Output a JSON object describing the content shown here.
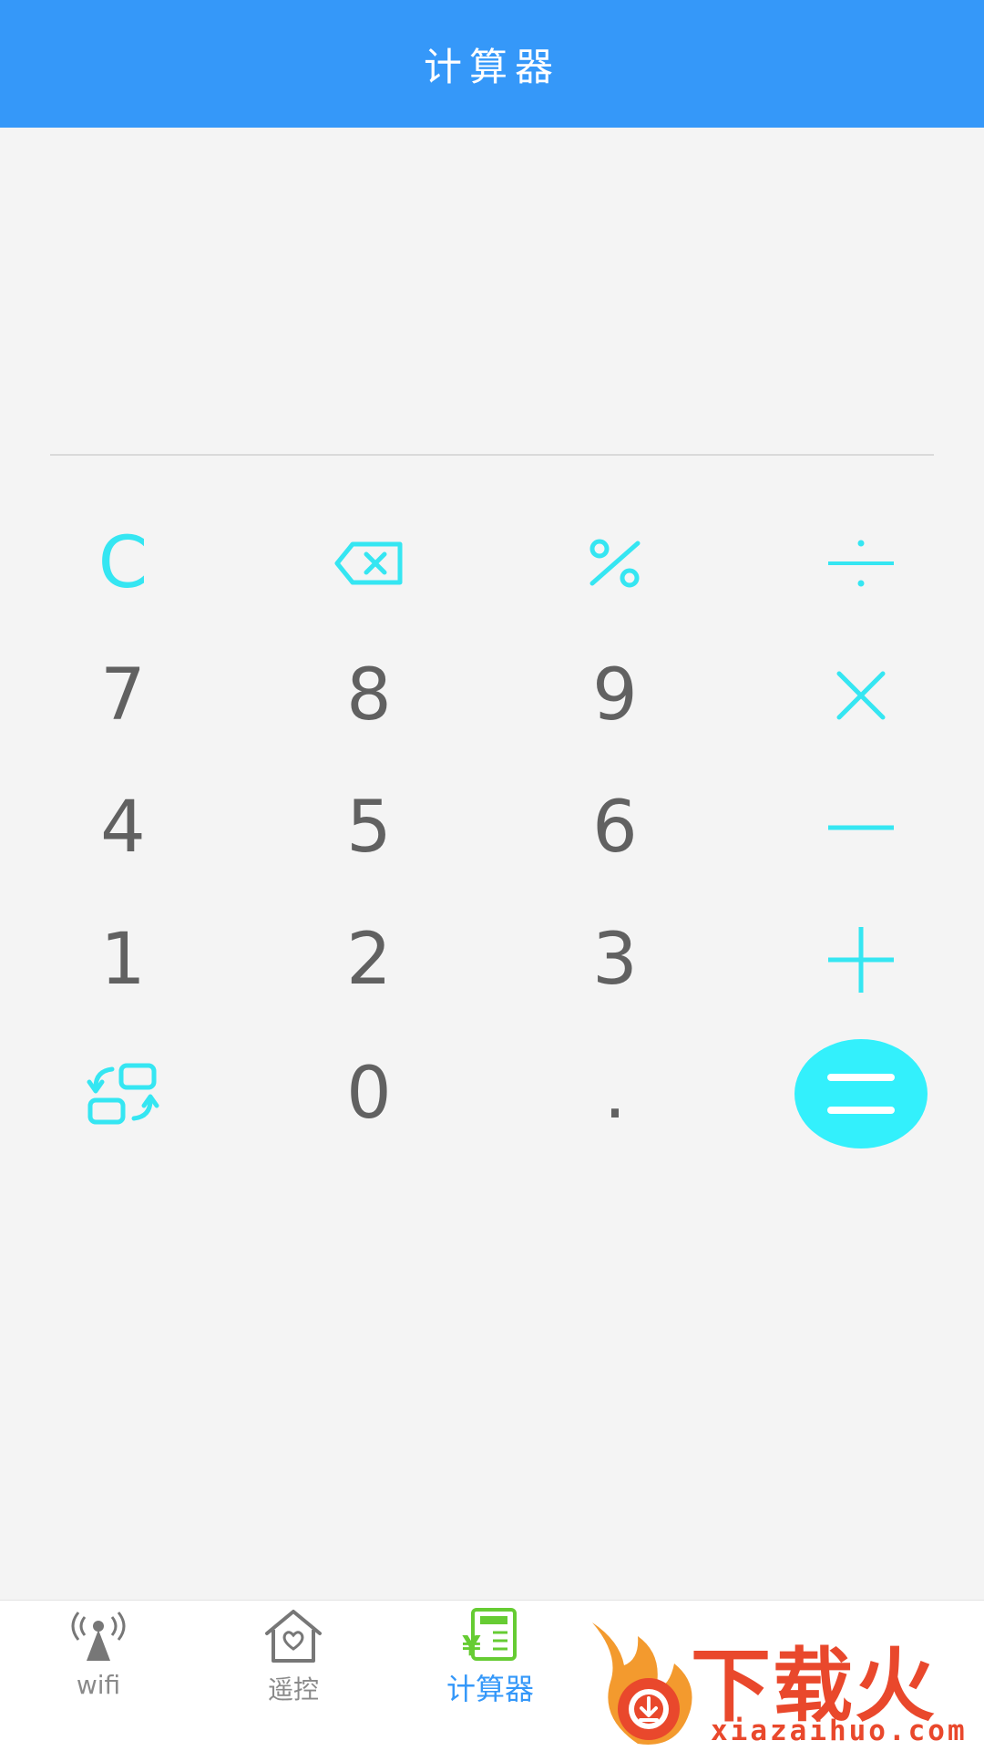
{
  "header": {
    "title": "计算器"
  },
  "display": {
    "value": ""
  },
  "keypad": {
    "clear": "C",
    "digits": {
      "seven": "7",
      "eight": "8",
      "nine": "9",
      "four": "4",
      "five": "5",
      "six": "6",
      "one": "1",
      "two": "2",
      "three": "3",
      "zero": "0",
      "dot": "."
    }
  },
  "nav": {
    "items": [
      {
        "label": "wifi"
      },
      {
        "label": "遥控"
      },
      {
        "label": "计算器"
      }
    ]
  },
  "watermark": {
    "brand": "下载火",
    "url": "xiazaihuo.com"
  },
  "colors": {
    "header": "#3598f9",
    "accent": "#35e6f2",
    "equals": "#33f0fc",
    "digit": "#616161",
    "nav_active": "#3598f9",
    "nav_icon_active": "#66cc33",
    "logo": "#e9482c"
  }
}
